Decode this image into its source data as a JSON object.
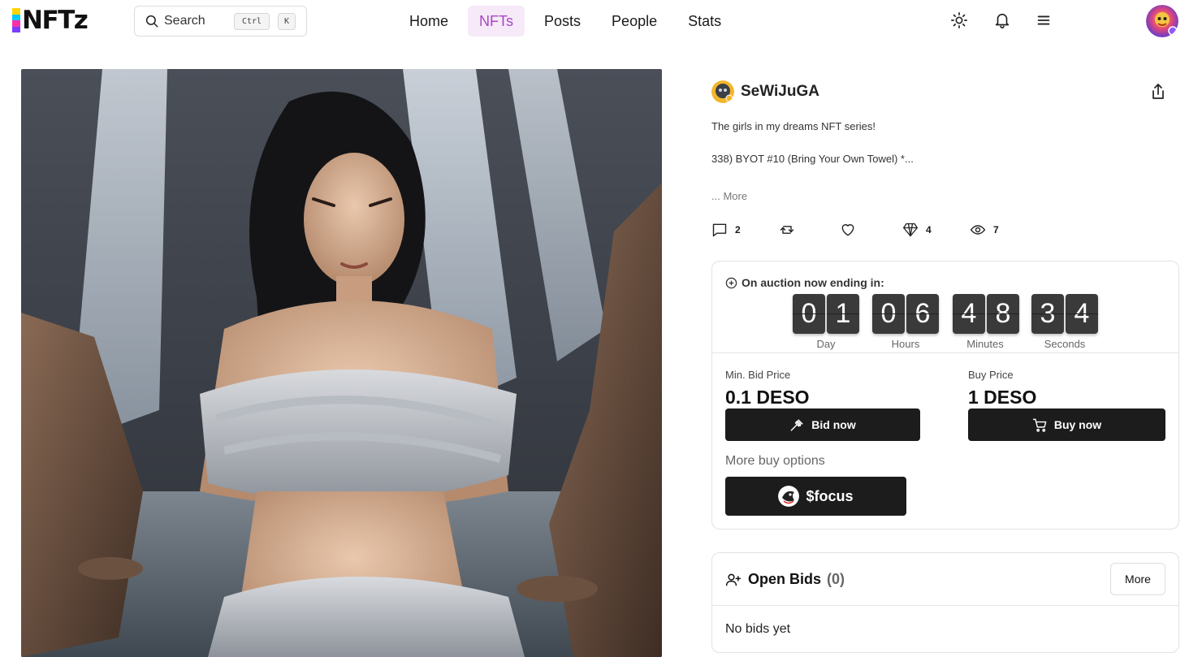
{
  "brand": {
    "name": "NFTz",
    "logo_bar_colors": [
      "#ffd400",
      "#00c8ff",
      "#ff2fa8",
      "#7a3cff",
      "#111111"
    ]
  },
  "search": {
    "label": "Search",
    "shortcut_ctrl": "Ctrl",
    "shortcut_key": "K"
  },
  "nav": {
    "items": [
      {
        "label": "Home",
        "active": false
      },
      {
        "label": "NFTs",
        "active": true
      },
      {
        "label": "Posts",
        "active": false
      },
      {
        "label": "People",
        "active": false
      },
      {
        "label": "Stats",
        "active": false
      }
    ]
  },
  "header_icons": [
    "sun-icon",
    "bell-icon",
    "menu-icon",
    "user-avatar"
  ],
  "post": {
    "creator": "SeWiJuGA",
    "description_line1": "The girls in my dreams NFT series!",
    "description_line2": "338) BYOT #10 (Bring Your Own Towel) *...",
    "more_link": "... More",
    "stats": {
      "comments": "2",
      "likes_icon": "heart-icon",
      "diamonds": "4",
      "views": "7"
    }
  },
  "auction": {
    "title": "On auction now ending in:",
    "countdown": {
      "day": [
        "0",
        "1"
      ],
      "hours": [
        "0",
        "6"
      ],
      "minutes": [
        "4",
        "8"
      ],
      "seconds": [
        "3",
        "4"
      ]
    },
    "units": {
      "day": "Day",
      "hours": "Hours",
      "minutes": "Minutes",
      "seconds": "Seconds"
    },
    "min_bid_label": "Min. Bid Price",
    "min_bid_value": "0.1 DESO",
    "buy_label": "Buy Price",
    "buy_value": "1 DESO",
    "bid_button": "Bid now",
    "buy_button": "Buy now",
    "more_buy_options": "More buy options",
    "focus_button": "$focus"
  },
  "open_bids": {
    "title": "Open Bids",
    "count": "(0)",
    "more_button": "More",
    "empty_text": "No bids yet"
  },
  "colors": {
    "accent": "#a945c4",
    "accent_bg": "#f6e9f8",
    "dark_button": "#1c1c1c",
    "countdown_tile": "#3a3a3a"
  }
}
